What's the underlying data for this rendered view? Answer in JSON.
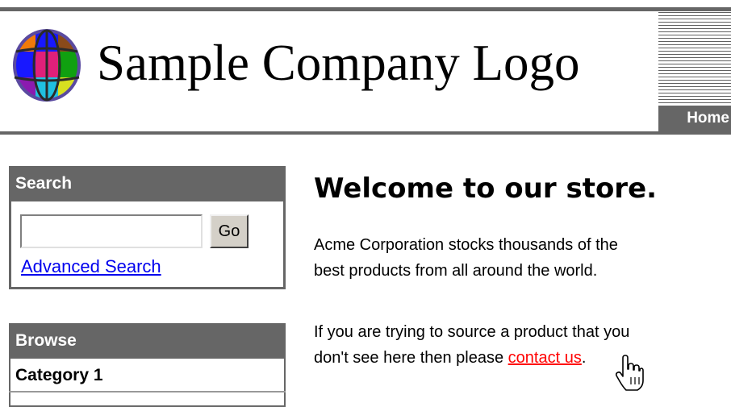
{
  "header": {
    "logo_text": "Sample Company Logo",
    "logo_icon": "globe-icon",
    "home_tab": "Home"
  },
  "search": {
    "title": "Search",
    "input_value": "",
    "go_label": "Go",
    "advanced_label": "Advanced Search"
  },
  "browse": {
    "title": "Browse",
    "items": [
      {
        "label": "Category 1"
      }
    ]
  },
  "main": {
    "heading": "Welcome to our store.",
    "para1_line1": "Acme Corporation stocks thousands of the",
    "para1_line2": "best products from all around the world.",
    "para2_line1": "If you are trying to source a product that you",
    "para2_line2_before": "don't see here then please ",
    "contact_label": "contact us",
    "para2_line2_after": "."
  },
  "cursor_icon": "hand-pointer-icon",
  "colors": {
    "header_gray": "#666666",
    "link_blue": "#0000ee",
    "contact_red": "#ff0000"
  }
}
